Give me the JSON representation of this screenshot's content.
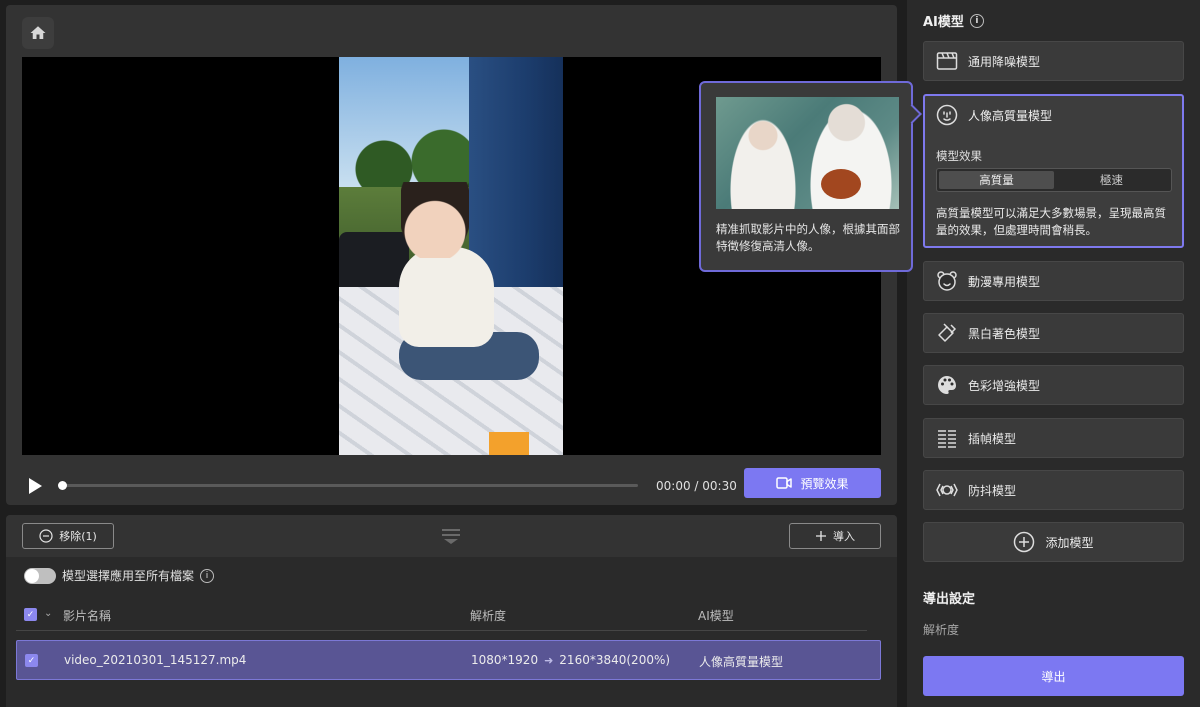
{
  "player": {
    "time": "00:00 / 00:30",
    "progress": 0,
    "preview_btn": "預覽效果"
  },
  "file_list": {
    "remove_btn": "移除(1)",
    "import_btn": "導入",
    "apply_all_label": "模型選擇應用至所有檔案",
    "apply_all_on": false,
    "columns": {
      "name": "影片名稱",
      "resolution": "解析度",
      "model": "AI模型"
    },
    "rows": [
      {
        "name": "video_20210301_145127.mp4",
        "res_from": "1080*1920",
        "res_to": "2160*3840(200%)",
        "model": "人像高質量模型",
        "checked": true
      }
    ]
  },
  "sidebar": {
    "title": "AI模型",
    "models": [
      {
        "label": "通用降噪模型",
        "icon": "clapperboard-icon"
      },
      {
        "label": "人像高質量模型",
        "icon": "face-icon",
        "active": true
      },
      {
        "label": "動漫專用模型",
        "icon": "bear-face-icon"
      },
      {
        "label": "黑白著色模型",
        "icon": "paint-bucket-icon"
      },
      {
        "label": "色彩增強模型",
        "icon": "palette-icon"
      },
      {
        "label": "插幀模型",
        "icon": "frame-interpolation-icon"
      },
      {
        "label": "防抖模型",
        "icon": "stabilizer-icon"
      },
      {
        "label": "添加模型",
        "icon": "plus-circle-icon"
      }
    ],
    "active_model": {
      "effect_label": "模型效果",
      "options": [
        "高質量",
        "極速"
      ],
      "selected": "高質量",
      "description": "高質量模型可以滿足大多數場景，呈現最高質量的效果，但處理時間會稍長。"
    },
    "export_title": "導出設定",
    "export_resolution_label": "解析度",
    "export_btn": "導出"
  },
  "tooltip": {
    "text": "精准抓取影片中的人像，根據其面部特徵修復高清人像。"
  },
  "colors": {
    "accent": "#7c78f2",
    "selected_row": "#595594",
    "panel": "#333333",
    "sidebar": "#2a2a2a"
  }
}
